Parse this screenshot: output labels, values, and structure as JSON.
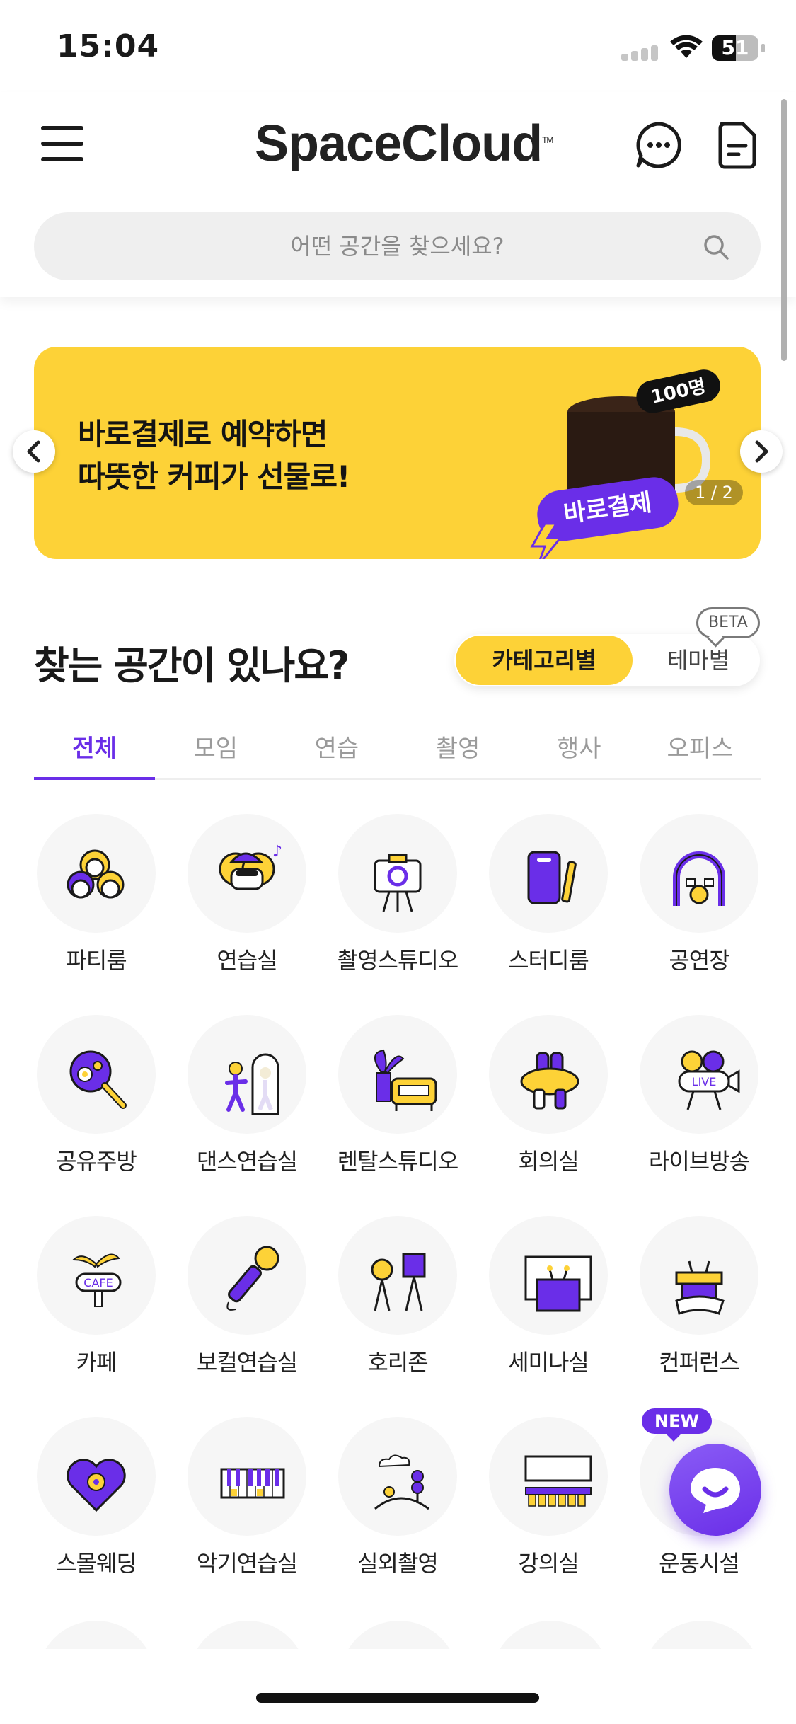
{
  "status_bar": {
    "time": "15:04",
    "battery": "51"
  },
  "header": {
    "logo": "SpaceCloud",
    "logo_tm": "TM",
    "search_placeholder": "어떤 공간을 찾으세요?"
  },
  "banner": {
    "line1": "바로결제로 예약하면",
    "line2": "따뜻한 커피가 선물로!",
    "badge_count": "100명",
    "badge_label": "바로결제",
    "counter": "1 / 2"
  },
  "section": {
    "title": "찾는 공간이 있나요?",
    "toggle_active": "카테고리별",
    "toggle_inactive": "테마별",
    "beta": "BETA"
  },
  "tabs": [
    "전체",
    "모임",
    "연습",
    "촬영",
    "행사",
    "오피스"
  ],
  "categories": [
    {
      "label": "파티룸",
      "icon": "party-people-icon"
    },
    {
      "label": "연습실",
      "icon": "practice-room-icon"
    },
    {
      "label": "촬영스튜디오",
      "icon": "camera-studio-icon"
    },
    {
      "label": "스터디룸",
      "icon": "study-room-icon"
    },
    {
      "label": "공연장",
      "icon": "stage-icon"
    },
    {
      "label": "공유주방",
      "icon": "shared-kitchen-icon"
    },
    {
      "label": "댄스연습실",
      "icon": "dance-studio-icon"
    },
    {
      "label": "렌탈스튜디오",
      "icon": "rental-studio-icon"
    },
    {
      "label": "회의실",
      "icon": "meeting-room-icon"
    },
    {
      "label": "라이브방송",
      "icon": "live-broadcast-icon"
    },
    {
      "label": "카페",
      "icon": "cafe-icon"
    },
    {
      "label": "보컬연습실",
      "icon": "microphone-icon"
    },
    {
      "label": "호리존",
      "icon": "horizon-studio-icon"
    },
    {
      "label": "세미나실",
      "icon": "seminar-room-icon"
    },
    {
      "label": "컨퍼런스",
      "icon": "conference-icon"
    },
    {
      "label": "스몰웨딩",
      "icon": "small-wedding-icon"
    },
    {
      "label": "악기연습실",
      "icon": "piano-icon"
    },
    {
      "label": "실외촬영",
      "icon": "outdoor-shoot-icon"
    },
    {
      "label": "강의실",
      "icon": "lecture-room-icon"
    },
    {
      "label": "운동시설",
      "icon": "gym-icon"
    }
  ],
  "new_badge": "NEW",
  "colors": {
    "accent": "#6a2ee8",
    "banner": "#fdd237",
    "text": "#1a1a1a"
  }
}
